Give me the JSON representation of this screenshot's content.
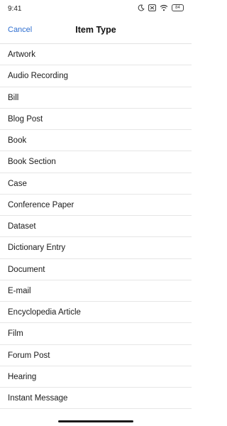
{
  "status_bar": {
    "time": "9:41",
    "battery_level": "84"
  },
  "header": {
    "cancel_label": "Cancel",
    "title": "Item Type"
  },
  "item_types": [
    "Artwork",
    "Audio Recording",
    "Bill",
    "Blog Post",
    "Book",
    "Book Section",
    "Case",
    "Conference Paper",
    "Dataset",
    "Dictionary Entry",
    "Document",
    "E-mail",
    "Encyclopedia Article",
    "Film",
    "Forum Post",
    "Hearing",
    "Instant Message"
  ],
  "colors": {
    "accent": "#2f6fd0",
    "divider": "#e6e6e6"
  }
}
